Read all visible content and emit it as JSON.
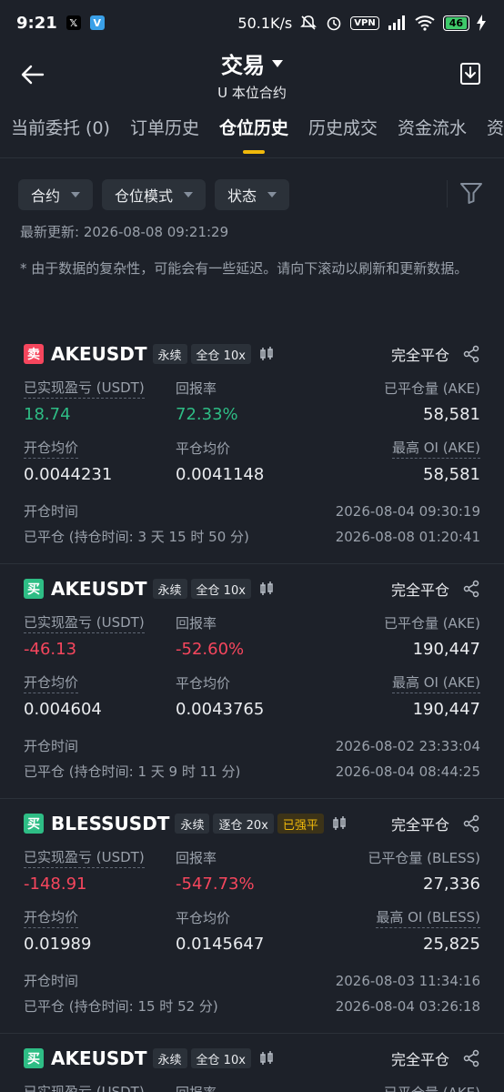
{
  "status_bar": {
    "time": "9:21",
    "speed": "50.1K/s",
    "battery": "46"
  },
  "header": {
    "title": "交易",
    "subtitle": "U 本位合约"
  },
  "tabs": [
    {
      "label": "当前委托 (0)"
    },
    {
      "label": "订单历史"
    },
    {
      "label": "仓位历史",
      "active": true
    },
    {
      "label": "历史成交"
    },
    {
      "label": "资金流水"
    },
    {
      "label": "资"
    }
  ],
  "filters": {
    "contract": "合约",
    "position_mode": "仓位模式",
    "status": "状态"
  },
  "last_update": "最新更新: 2026-08-08 09:21:29",
  "note": "* 由于数据的复杂性，可能会有一些延迟。请向下滚动以刷新和更新数据。",
  "labels": {
    "pnl": "已实现盈亏 (USDT)",
    "roi": "回报率",
    "open_price": "开仓均价",
    "close_price": "平仓均价",
    "open_time": "开仓时间"
  },
  "positions": [
    {
      "side": "卖",
      "symbol": "AKEUSDT",
      "type": "永续",
      "margin": "全仓 10x",
      "status": "完全平仓",
      "pnl": "18.74",
      "roi": "72.33%",
      "closed_qty_label": "已平仓量 (AKE)",
      "closed_qty": "58,581",
      "open_price": "0.0044231",
      "close_price": "0.0041148",
      "max_oi_label": "最高 OI (AKE)",
      "max_oi": "58,581",
      "open_time": "2026-08-04 09:30:19",
      "closed_label": "已平仓 (持仓时间: 3 天 15 时 50 分)",
      "closed_time": "2026-08-08 01:20:41"
    },
    {
      "side": "买",
      "symbol": "AKEUSDT",
      "type": "永续",
      "margin": "全仓 10x",
      "status": "完全平仓",
      "pnl": "-46.13",
      "roi": "-52.60%",
      "closed_qty_label": "已平仓量 (AKE)",
      "closed_qty": "190,447",
      "open_price": "0.004604",
      "close_price": "0.0043765",
      "max_oi_label": "最高 OI (AKE)",
      "max_oi": "190,447",
      "open_time": "2026-08-02 23:33:04",
      "closed_label": "已平仓 (持仓时间: 1 天 9 时 11 分)",
      "closed_time": "2026-08-04 08:44:25"
    },
    {
      "side": "买",
      "symbol": "BLESSUSDT",
      "type": "永续",
      "margin": "逐仓 20x",
      "extra_tag": "已强平",
      "status": "完全平仓",
      "pnl": "-148.91",
      "roi": "-547.73%",
      "closed_qty_label": "已平仓量 (BLESS)",
      "closed_qty": "27,336",
      "open_price": "0.01989",
      "close_price": "0.0145647",
      "max_oi_label": "最高 OI (BLESS)",
      "max_oi": "25,825",
      "open_time": "2026-08-03 11:34:16",
      "closed_label": "已平仓 (持仓时间: 15 时 52 分)",
      "closed_time": "2026-08-04 03:26:18"
    },
    {
      "side": "买",
      "symbol": "AKEUSDT",
      "type": "永续",
      "margin": "全仓 10x",
      "status": "完全平仓",
      "closed_qty_label": "已平仓量 (AKE)"
    }
  ],
  "colors": {
    "background": "#1d2129",
    "accent": "#f0b90b",
    "positive": "#2ebd85",
    "negative": "#f6465d"
  }
}
